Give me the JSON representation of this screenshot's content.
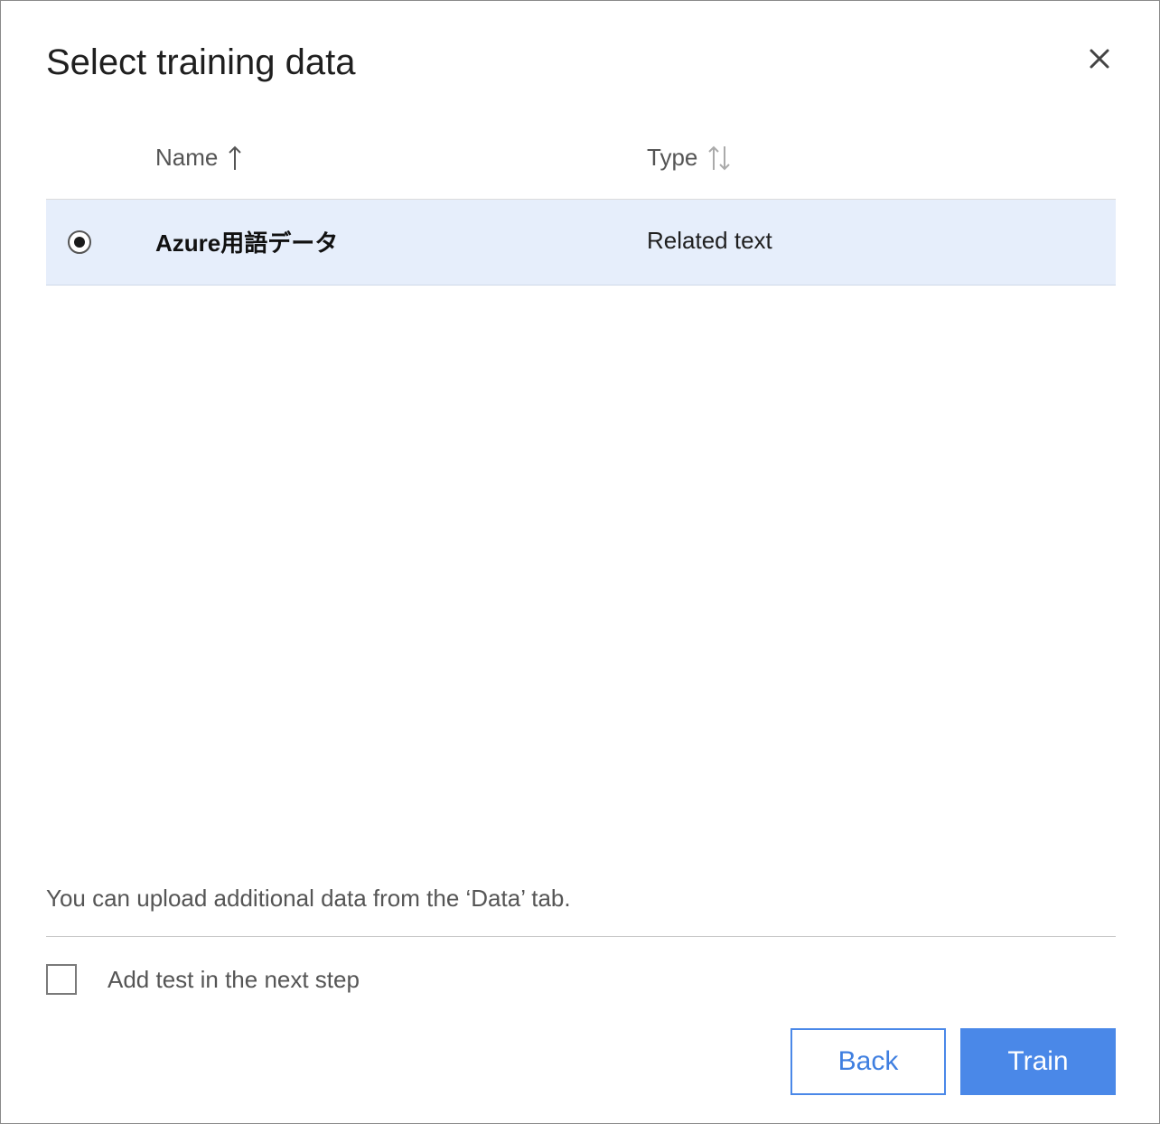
{
  "dialog": {
    "title": "Select training data",
    "close_icon": "close-icon"
  },
  "table": {
    "columns": [
      {
        "label": "Name",
        "sort_icon": "sort-ascending-icon"
      },
      {
        "label": "Type",
        "sort_icon": "sort-both-icon"
      }
    ],
    "rows": [
      {
        "selected": true,
        "name": "Azure用語データ",
        "type": "Related text"
      }
    ]
  },
  "info_text": "You can upload additional data from the ‘Data’ tab.",
  "add_test": {
    "label": "Add test in the next step",
    "checked": false
  },
  "buttons": {
    "back_label": "Back",
    "train_label": "Train"
  },
  "colors": {
    "accent": "#4a88e8",
    "selected_row_bg": "#e6eefb"
  }
}
